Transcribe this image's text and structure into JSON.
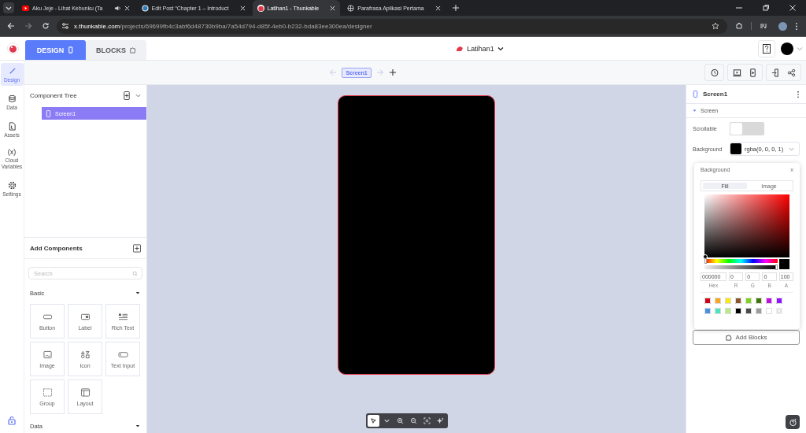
{
  "browser": {
    "tabs": [
      {
        "title": "Aku Jeje - Lihat Kebunku (Ta",
        "kind": "video",
        "audio": true,
        "selected": false
      },
      {
        "title": "Edit Post “Chapter 1 – Introduct",
        "kind": "blog",
        "audio": false,
        "selected": false
      },
      {
        "title": "Latihan1 - Thunkable",
        "kind": "app",
        "audio": false,
        "selected": true
      },
      {
        "title": "Parafrasa Aplikasi Pertama",
        "kind": "web",
        "audio": false,
        "selected": false
      }
    ],
    "url_host": "x.thunkable.com",
    "url_path": "/projects/69699fb4c3abf6d48730b9ba/7a54d794-d85f-4eb0-b232-bda83ee300ea/designer"
  },
  "header": {
    "tabs": [
      {
        "label": "DESIGN",
        "kind": "phone",
        "selected": true
      },
      {
        "label": "BLOCKS",
        "kind": "puzzle",
        "selected": false
      }
    ],
    "project": "Latihan1"
  },
  "toolbar": {
    "screen_chip": "Screen1"
  },
  "rail": [
    {
      "label": "Design",
      "kind": "brush",
      "selected": true
    },
    {
      "label": "Data",
      "kind": "database",
      "selected": false
    },
    {
      "label": "Assets",
      "kind": "file",
      "selected": false
    },
    {
      "label": "Cloud Variables",
      "kind": "text",
      "icon_text": "(x)",
      "selected": false
    },
    {
      "label": "Settings",
      "kind": "gear",
      "selected": false
    }
  ],
  "component_tree": {
    "title": "Component Tree",
    "items": [
      {
        "label": "Screen1",
        "selected": true
      }
    ]
  },
  "add_components": {
    "title": "Add Components",
    "search": {
      "placeholder": "Search"
    },
    "sections": [
      {
        "title": "Basic",
        "expanded": true,
        "items": [
          {
            "label": "Button",
            "kind": "button"
          },
          {
            "label": "Label",
            "kind": "label"
          },
          {
            "label": "Rich Text",
            "kind": "richtext"
          },
          {
            "label": "Image",
            "kind": "image"
          },
          {
            "label": "Icon",
            "kind": "icon"
          },
          {
            "label": "Text Input",
            "kind": "textinput"
          },
          {
            "label": "Group",
            "kind": "group"
          },
          {
            "label": "Layout",
            "kind": "layout"
          }
        ]
      },
      {
        "title": "Data",
        "expanded": true
      }
    ]
  },
  "canvas_tools": [
    {
      "kind": "pointer",
      "selected": true
    },
    {
      "kind": "caret",
      "selected": false
    },
    {
      "kind": "zoom-in",
      "selected": false
    },
    {
      "kind": "zoom-out",
      "selected": false
    },
    {
      "kind": "fit",
      "selected": false
    },
    {
      "kind": "sparkle",
      "selected": false
    }
  ],
  "properties": {
    "title": "Screen1",
    "section": "Screen",
    "rows": [
      {
        "label": "Scrollable",
        "kind": "toggle",
        "on": false
      },
      {
        "label": "Background",
        "kind": "color",
        "value": "rgba(0, 0, 0, 1)",
        "color": "#000000"
      }
    ],
    "add_blocks": "Add Blocks"
  },
  "color_picker": {
    "title": "Background",
    "close": "x",
    "tabs": [
      {
        "label": "Fill",
        "selected": true
      },
      {
        "label": "Image",
        "selected": false
      }
    ],
    "hue": {
      "level": 0
    },
    "alpha": {
      "level": 1
    },
    "fields": [
      {
        "value": "000000",
        "label": "Hex"
      },
      {
        "value": "0",
        "label": "R"
      },
      {
        "value": "0",
        "label": "G"
      },
      {
        "value": "0",
        "label": "B"
      },
      {
        "value": "100",
        "label": "A"
      }
    ],
    "swatches": [
      {
        "kind": "solid",
        "color": "#d0021b"
      },
      {
        "kind": "solid",
        "color": "#f5a623"
      },
      {
        "kind": "solid",
        "color": "#f8e71c"
      },
      {
        "kind": "solid",
        "color": "#8b572a"
      },
      {
        "kind": "solid",
        "color": "#7ed321"
      },
      {
        "kind": "solid",
        "color": "#417505"
      },
      {
        "kind": "solid",
        "color": "#bd10e0"
      },
      {
        "kind": "solid",
        "color": "#9013fe"
      },
      {
        "kind": "solid",
        "color": "#4a90e2"
      },
      {
        "kind": "solid",
        "color": "#50e3c2"
      },
      {
        "kind": "solid",
        "color": "#b8e986"
      },
      {
        "kind": "solid",
        "color": "#000000"
      },
      {
        "kind": "solid",
        "color": "#4a4a4a"
      },
      {
        "kind": "solid",
        "color": "#9b9b9b"
      },
      {
        "kind": "solid",
        "color": "#ffffff"
      },
      {
        "kind": "transparent"
      }
    ]
  }
}
